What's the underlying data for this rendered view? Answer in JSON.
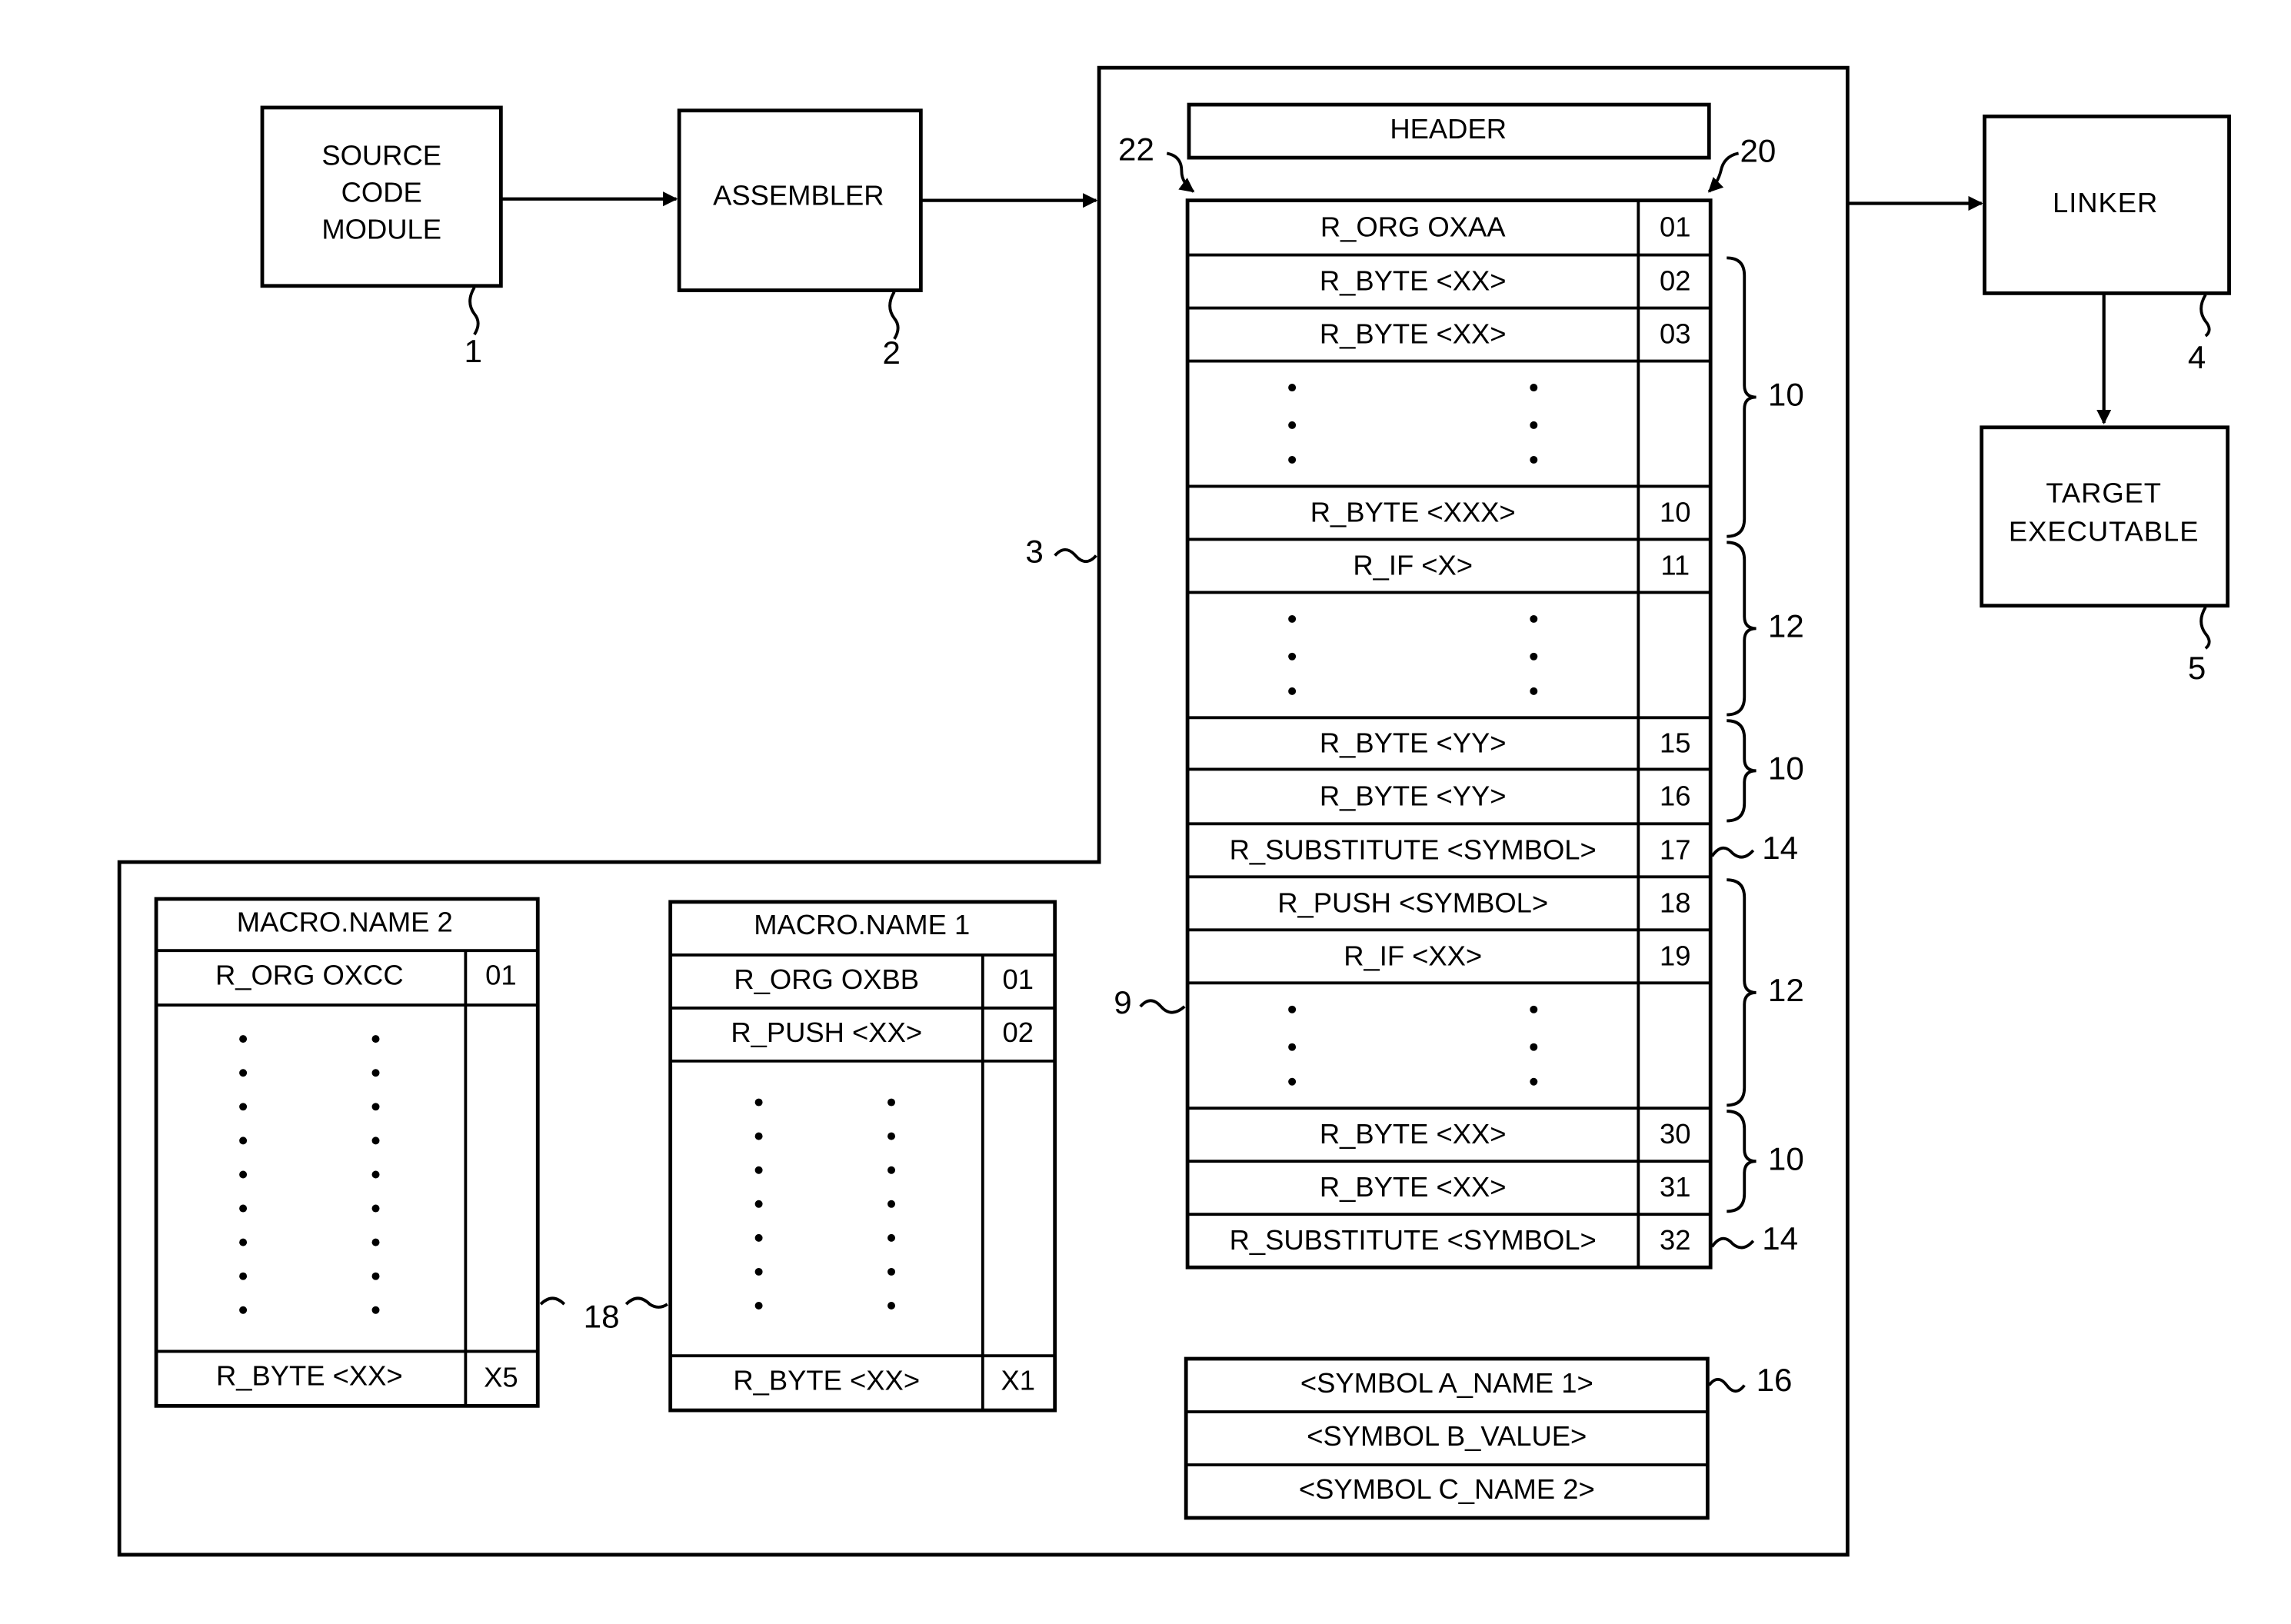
{
  "diagram": {
    "blocks": {
      "source_code_module": {
        "lines": [
          "SOURCE",
          "CODE",
          "MODULE"
        ],
        "ref": "1"
      },
      "assembler": {
        "label": "ASSEMBLER",
        "ref": "2"
      },
      "object_file": {
        "ref": "3"
      },
      "linker": {
        "label": "LINKER",
        "ref": "4"
      },
      "target_executable": {
        "lines": [
          "TARGET",
          "EXECUTABLE"
        ],
        "ref": "5"
      }
    },
    "header": {
      "label": "HEADER"
    },
    "record_table": {
      "ref": "9",
      "left_ref": "22",
      "right_ref": "20",
      "rows": [
        {
          "text": "R_ORG OXAA",
          "num": "01"
        },
        {
          "text": "R_BYTE <XX>",
          "num": "02"
        },
        {
          "text": "R_BYTE <XX>",
          "num": "03"
        },
        {
          "text": "",
          "num": "",
          "ellipsis": true
        },
        {
          "text": "R_BYTE <XXX>",
          "num": "10"
        },
        {
          "text": "R_IF <X>",
          "num": "11"
        },
        {
          "text": "",
          "num": "",
          "ellipsis": true
        },
        {
          "text": "R_BYTE <YY>",
          "num": "15"
        },
        {
          "text": "R_BYTE <YY>",
          "num": "16"
        },
        {
          "text": "R_SUBSTITUTE <SYMBOL>",
          "num": "17"
        },
        {
          "text": "R_PUSH <SYMBOL>",
          "num": "18"
        },
        {
          "text": "R_IF <XX>",
          "num": "19"
        },
        {
          "text": "",
          "num": "",
          "ellipsis": true
        },
        {
          "text": "R_BYTE <XX>",
          "num": "30"
        },
        {
          "text": "R_BYTE <XX>",
          "num": "31"
        },
        {
          "text": "R_SUBSTITUTE <SYMBOL>",
          "num": "32"
        }
      ],
      "groups": [
        {
          "label": "10"
        },
        {
          "label": "12"
        },
        {
          "label": "10"
        },
        {
          "label": "14"
        },
        {
          "label": "12"
        },
        {
          "label": "10"
        },
        {
          "label": "14"
        }
      ]
    },
    "symbol_table": {
      "ref": "16",
      "rows": [
        "<SYMBOL A_NAME 1>",
        "<SYMBOL B_VALUE>",
        "<SYMBOL C_NAME 2>"
      ]
    },
    "macros": {
      "ref": "18",
      "macro2": {
        "title": "MACRO.NAME 2",
        "first": {
          "text": "R_ORG OXCC",
          "num": "01"
        },
        "last": {
          "text": "R_BYTE <XX>",
          "num": "X5"
        }
      },
      "macro1": {
        "title": "MACRO.NAME 1",
        "first": {
          "text": "R_ORG OXBB",
          "num": "01"
        },
        "second": {
          "text": "R_PUSH <XX>",
          "num": "02"
        },
        "last": {
          "text": "R_BYTE <XX>",
          "num": "X1"
        }
      }
    }
  }
}
